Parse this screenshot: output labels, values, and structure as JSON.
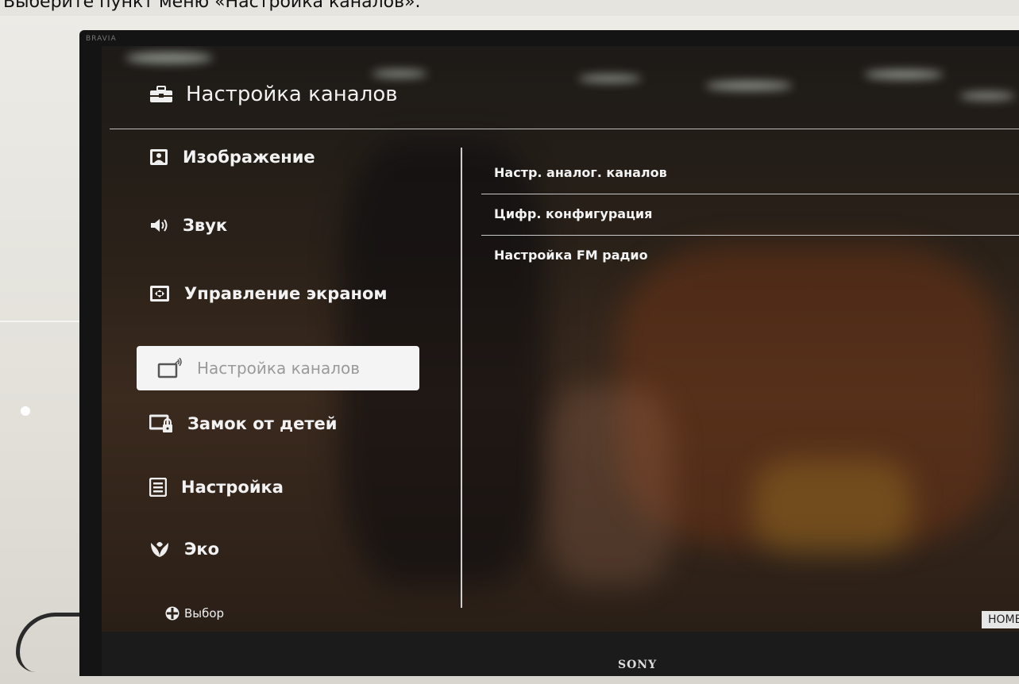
{
  "caption": "Выберите пункт меню «Настройка каналов».",
  "tv": {
    "bezel_label": "BRAVIA",
    "brand_logo": "SONY"
  },
  "header": {
    "title": "Настройка каналов",
    "icon": "toolbox-icon"
  },
  "sidebar": {
    "items": [
      {
        "label": "Изображение",
        "icon": "picture-icon"
      },
      {
        "label": "Звук",
        "icon": "speaker-icon"
      },
      {
        "label": "Управление экраном",
        "icon": "screen-control-icon"
      },
      {
        "label": "Настройка каналов",
        "icon": "tv-antenna-icon",
        "selected": true
      },
      {
        "label": "Замок от детей",
        "icon": "child-lock-icon"
      },
      {
        "label": "Настройка",
        "icon": "settings-list-icon"
      },
      {
        "label": "Эко",
        "icon": "eco-leaf-icon"
      }
    ]
  },
  "submenu": {
    "items": [
      {
        "label": "Настр. аналог. каналов"
      },
      {
        "label": "Цифр. конфигурация"
      },
      {
        "label": "Настройка FM радио"
      }
    ]
  },
  "footer": {
    "hint": "Выбор",
    "home_button": "HOME"
  },
  "colors": {
    "selected_bg": "#f4f4f4",
    "selected_text": "#9a9a9a",
    "text": "#f2f2f2",
    "divider": "#cfcfcf"
  }
}
